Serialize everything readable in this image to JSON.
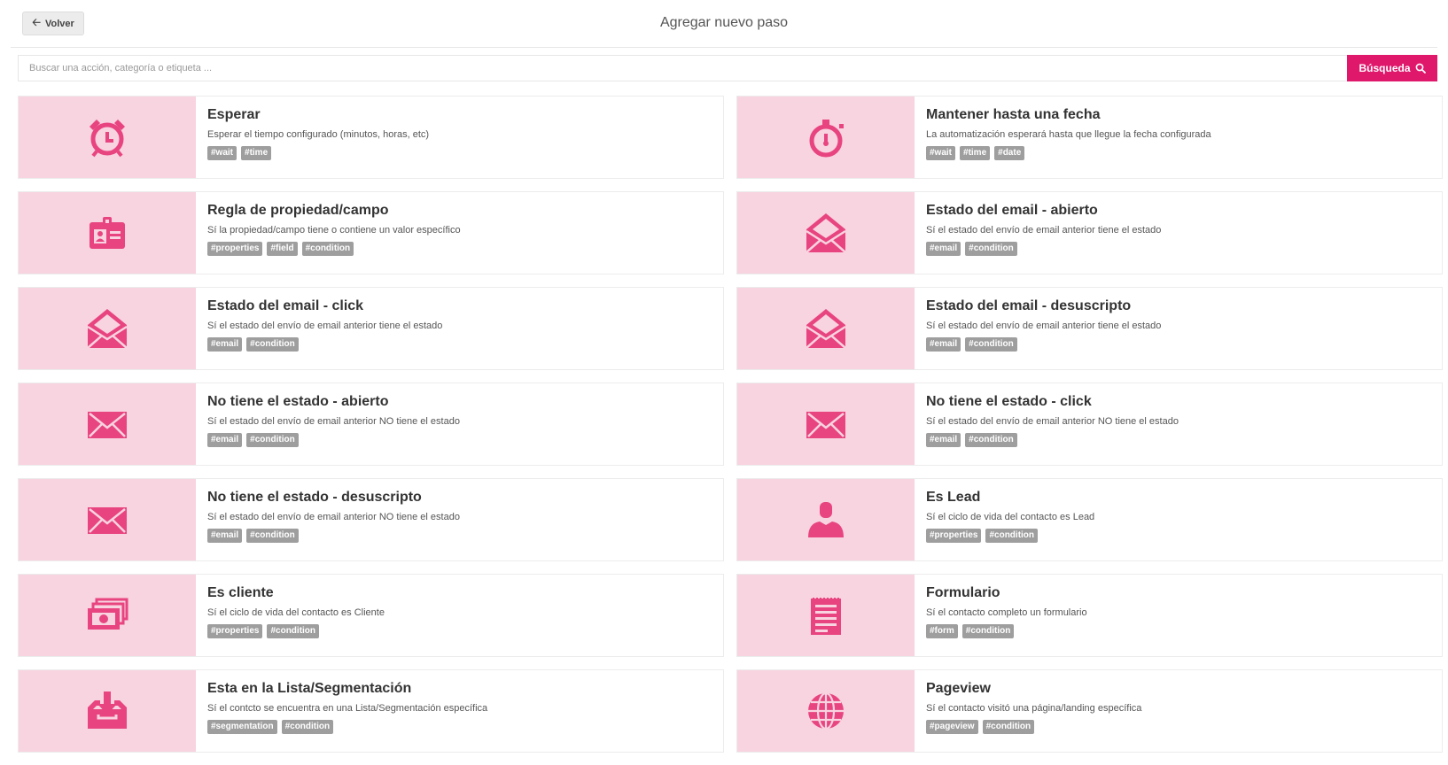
{
  "header": {
    "back_label": "Volver",
    "title": "Agregar nuevo paso"
  },
  "search": {
    "placeholder": "Buscar una acción, categoría o etiqueta ...",
    "button_label": "Búsqueda"
  },
  "colors": {
    "accent": "#e0186c",
    "icon_bg": "#f8d3e0",
    "icon_fg": "#e8447f",
    "tag_bg": "#9e9e9e"
  },
  "cards": [
    {
      "title": "Esperar",
      "desc": "Esperar el tiempo configurado (minutos, horas, etc)",
      "tags": [
        "#wait",
        "#time"
      ],
      "icon": "alarm-clock-icon"
    },
    {
      "title": "Mantener hasta una fecha",
      "desc": "La automatización esperará hasta que llegue la fecha configurada",
      "tags": [
        "#wait",
        "#time",
        "#date"
      ],
      "icon": "stopwatch-icon"
    },
    {
      "title": "Regla de propiedad/campo",
      "desc": "Sí la propiedad/campo tiene o contiene un valor específico",
      "tags": [
        "#properties",
        "#field",
        "#condition"
      ],
      "icon": "id-card-icon"
    },
    {
      "title": "Estado del email - abierto",
      "desc": "Sí el estado del envío de email anterior tiene el estado",
      "tags": [
        "#email",
        "#condition"
      ],
      "icon": "open-envelope-icon"
    },
    {
      "title": "Estado del email - click",
      "desc": "Sí el estado del envío de email anterior tiene el estado",
      "tags": [
        "#email",
        "#condition"
      ],
      "icon": "open-envelope-icon"
    },
    {
      "title": "Estado del email - desuscripto",
      "desc": "Sí el estado del envío de email anterior tiene el estado",
      "tags": [
        "#email",
        "#condition"
      ],
      "icon": "open-envelope-icon"
    },
    {
      "title": "No tiene el estado - abierto",
      "desc": "Sí el estado del envío de email anterior NO tiene el estado",
      "tags": [
        "#email",
        "#condition"
      ],
      "icon": "envelope-icon"
    },
    {
      "title": "No tiene el estado - click",
      "desc": "Sí el estado del envío de email anterior NO tiene el estado",
      "tags": [
        "#email",
        "#condition"
      ],
      "icon": "envelope-icon"
    },
    {
      "title": "No tiene el estado - desuscripto",
      "desc": "Sí el estado del envío de email anterior NO tiene el estado",
      "tags": [
        "#email",
        "#condition"
      ],
      "icon": "envelope-icon"
    },
    {
      "title": "Es Lead",
      "desc": "Sí el ciclo de vida del contacto es Lead",
      "tags": [
        "#properties",
        "#condition"
      ],
      "icon": "user-icon"
    },
    {
      "title": "Es cliente",
      "desc": "Sí el ciclo de vida del contacto es Cliente",
      "tags": [
        "#properties",
        "#condition"
      ],
      "icon": "money-icon"
    },
    {
      "title": "Formulario",
      "desc": "Sí el contacto completo un formulario",
      "tags": [
        "#form",
        "#condition"
      ],
      "icon": "form-icon"
    },
    {
      "title": "Esta en la Lista/Segmentación",
      "desc": "Sí el contcto se encuentra en una Lista/Segmentación específica",
      "tags": [
        "#segmentation",
        "#condition"
      ],
      "icon": "inbox-download-icon"
    },
    {
      "title": "Pageview",
      "desc": "Sí el contacto visitó una página/landing específica",
      "tags": [
        "#pageview",
        "#condition"
      ],
      "icon": "globe-icon"
    }
  ]
}
